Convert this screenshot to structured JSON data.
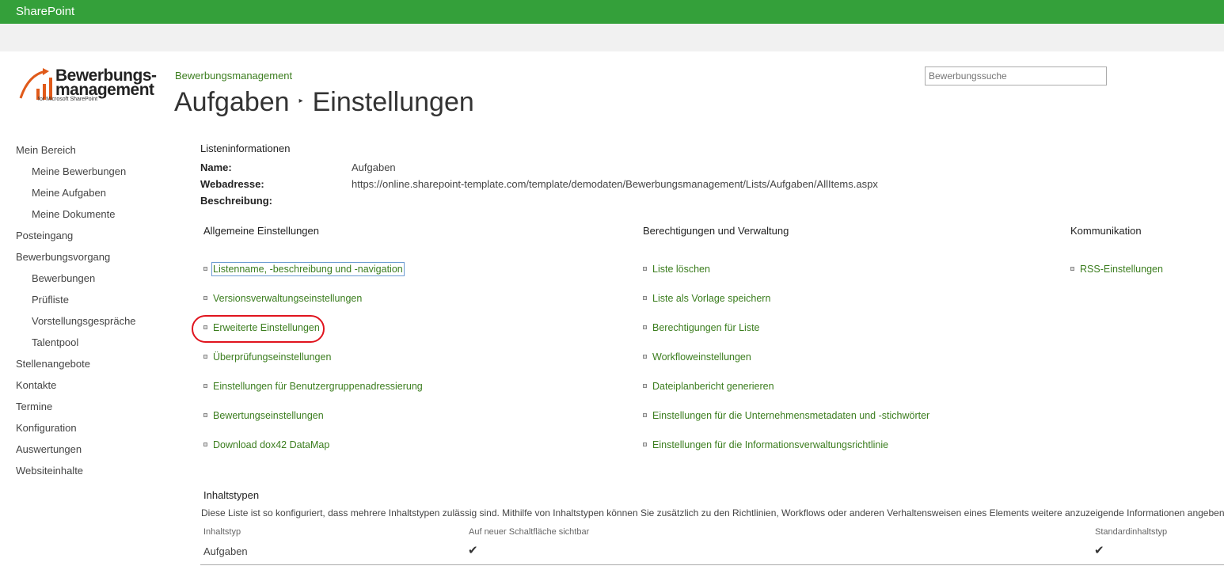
{
  "topbar": {
    "brand": "SharePoint"
  },
  "logo": {
    "line1": "Bewerbungs-",
    "line2": "management",
    "tagline": "for Microsoft SharePoint"
  },
  "header": {
    "breadcrumb": "Bewerbungsmanagement",
    "title_part1": "Aufgaben",
    "separator": "▸",
    "title_part2": "Einstellungen"
  },
  "search": {
    "placeholder": "Bewerbungssuche"
  },
  "nav": {
    "items": [
      {
        "label": "Mein Bereich",
        "level": 0
      },
      {
        "label": "Meine Bewerbungen",
        "level": 1
      },
      {
        "label": "Meine Aufgaben",
        "level": 1
      },
      {
        "label": "Meine Dokumente",
        "level": 1
      },
      {
        "label": "Posteingang",
        "level": 0
      },
      {
        "label": "Bewerbungsvorgang",
        "level": 0
      },
      {
        "label": "Bewerbungen",
        "level": 1
      },
      {
        "label": "Prüfliste",
        "level": 1
      },
      {
        "label": "Vorstellungsgespräche",
        "level": 1
      },
      {
        "label": "Talentpool",
        "level": 1
      },
      {
        "label": "Stellenangebote",
        "level": 0
      },
      {
        "label": "Kontakte",
        "level": 0
      },
      {
        "label": "Termine",
        "level": 0
      },
      {
        "label": "Konfiguration",
        "level": 0
      },
      {
        "label": "Auswertungen",
        "level": 0
      },
      {
        "label": "Websiteinhalte",
        "level": 0
      }
    ]
  },
  "list_info": {
    "section_title": "Listeninformationen",
    "name_label": "Name:",
    "name_value": "Aufgaben",
    "url_label": "Webadresse:",
    "url_value": "https://online.sharepoint-template.com/template/demodaten/Bewerbungsmanagement/Lists/Aufgaben/AllItems.aspx",
    "desc_label": "Beschreibung:"
  },
  "columns": {
    "general": {
      "title": "Allgemeine Einstellungen",
      "links": [
        "Listenname, -beschreibung und -navigation",
        "Versionsverwaltungseinstellungen",
        "Erweiterte Einstellungen",
        "Überprüfungseinstellungen",
        "Einstellungen für Benutzergruppenadressierung",
        "Bewertungseinstellungen",
        "Download dox42 DataMap"
      ]
    },
    "permissions": {
      "title": "Berechtigungen und Verwaltung",
      "links": [
        "Liste löschen",
        "Liste als Vorlage speichern",
        "Berechtigungen für Liste",
        "Workfloweinstellungen",
        "Dateiplanbericht generieren",
        "Einstellungen für die Unternehmensmetadaten und -stichwörter",
        "Einstellungen für die Informationsverwaltungsrichtlinie"
      ]
    },
    "communication": {
      "title": "Kommunikation",
      "links": [
        "RSS-Einstellungen"
      ]
    }
  },
  "content_types": {
    "title": "Inhaltstypen",
    "description": "Diese Liste ist so konfiguriert, dass mehrere Inhaltstypen zulässig sind. Mithilfe von Inhaltstypen können Sie zusätzlich zu den Richtlinien, Workflows oder anderen Verhaltensweisen eines Elements weitere anzuzeigende Informationen angeben. Die folg",
    "headers": [
      "Inhaltstyp",
      "Auf neuer Schaltfläche sichtbar",
      "Standardinhaltstyp"
    ],
    "rows": [
      {
        "name": "Aufgaben",
        "visible": "✔",
        "default": "✔"
      }
    ]
  },
  "colors": {
    "brand_green": "#34a03a",
    "link_green": "#3b7d1e",
    "highlight_red": "#e0141e"
  }
}
